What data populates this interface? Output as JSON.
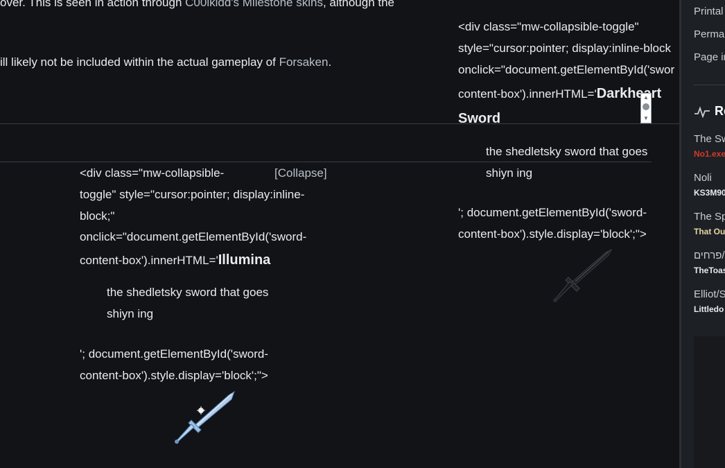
{
  "main": {
    "top_text_1": "over. This is seen in action through",
    "top_link_1": "C00lkidd's Milestone skins",
    "top_text_2": ", although the",
    "top_text_3": "ill likely not be included within the actual gameplay of",
    "top_link_2": "Forsaken",
    "top_text_4": ".",
    "left_block": {
      "line1": "<div class=\"mw-collapsible-",
      "collapse_label": "[Collapse]",
      "line2": "toggle\" style=\"cursor:pointer; display:inline-",
      "line3": "block;\"",
      "line4": "onclick=\"document.getElementById('sword-",
      "line5_prefix": "content-box').innerHTML='",
      "line5_bold": "Illumina",
      "desc1": "the shedletsky sword that goes",
      "desc2": "shiyn ing",
      "line6": "'; document.getElementById('sword-",
      "line7": "content-box').style.display='block';\">"
    },
    "right_block": {
      "line1": "<div class=\"mw-collapsible-toggle\"",
      "line2": "style=\"cursor:pointer; display:inline-block",
      "line3": "onclick=\"document.getElementById('swor",
      "line4_prefix": "content-box').innerHTML='",
      "line4_bold": "Darkheart",
      "line5_bold": "Sword",
      "desc1": "the shedletsky sword that goes",
      "desc2": "shiyn ing",
      "line6": "'; document.getElementById('sword-",
      "line7": "content-box').style.display='block';\">"
    }
  },
  "sidebar": {
    "items": [
      "Printal",
      "Perma",
      "Page in"
    ],
    "recent_title": "Re",
    "recent": [
      {
        "title": "The Sw",
        "user": "No1.exe",
        "user_color": "#d23a2a"
      },
      {
        "title": "Noli",
        "user": "KS3M90",
        "user_color": "#e8eaee"
      },
      {
        "title": "The Sp",
        "user": "That Ou",
        "user_color": "#e6d7a6"
      },
      {
        "title": "פרחים/",
        "user": "TheToas",
        "user_color": "#e8eaee"
      },
      {
        "title": "Elliot/S",
        "user": "Littledo",
        "user_color": "#e8eaee"
      }
    ]
  },
  "colors": {
    "background": "#111317",
    "sidebar": "#1d2025",
    "link": "#b9c0c9",
    "text": "#e9ebef"
  }
}
